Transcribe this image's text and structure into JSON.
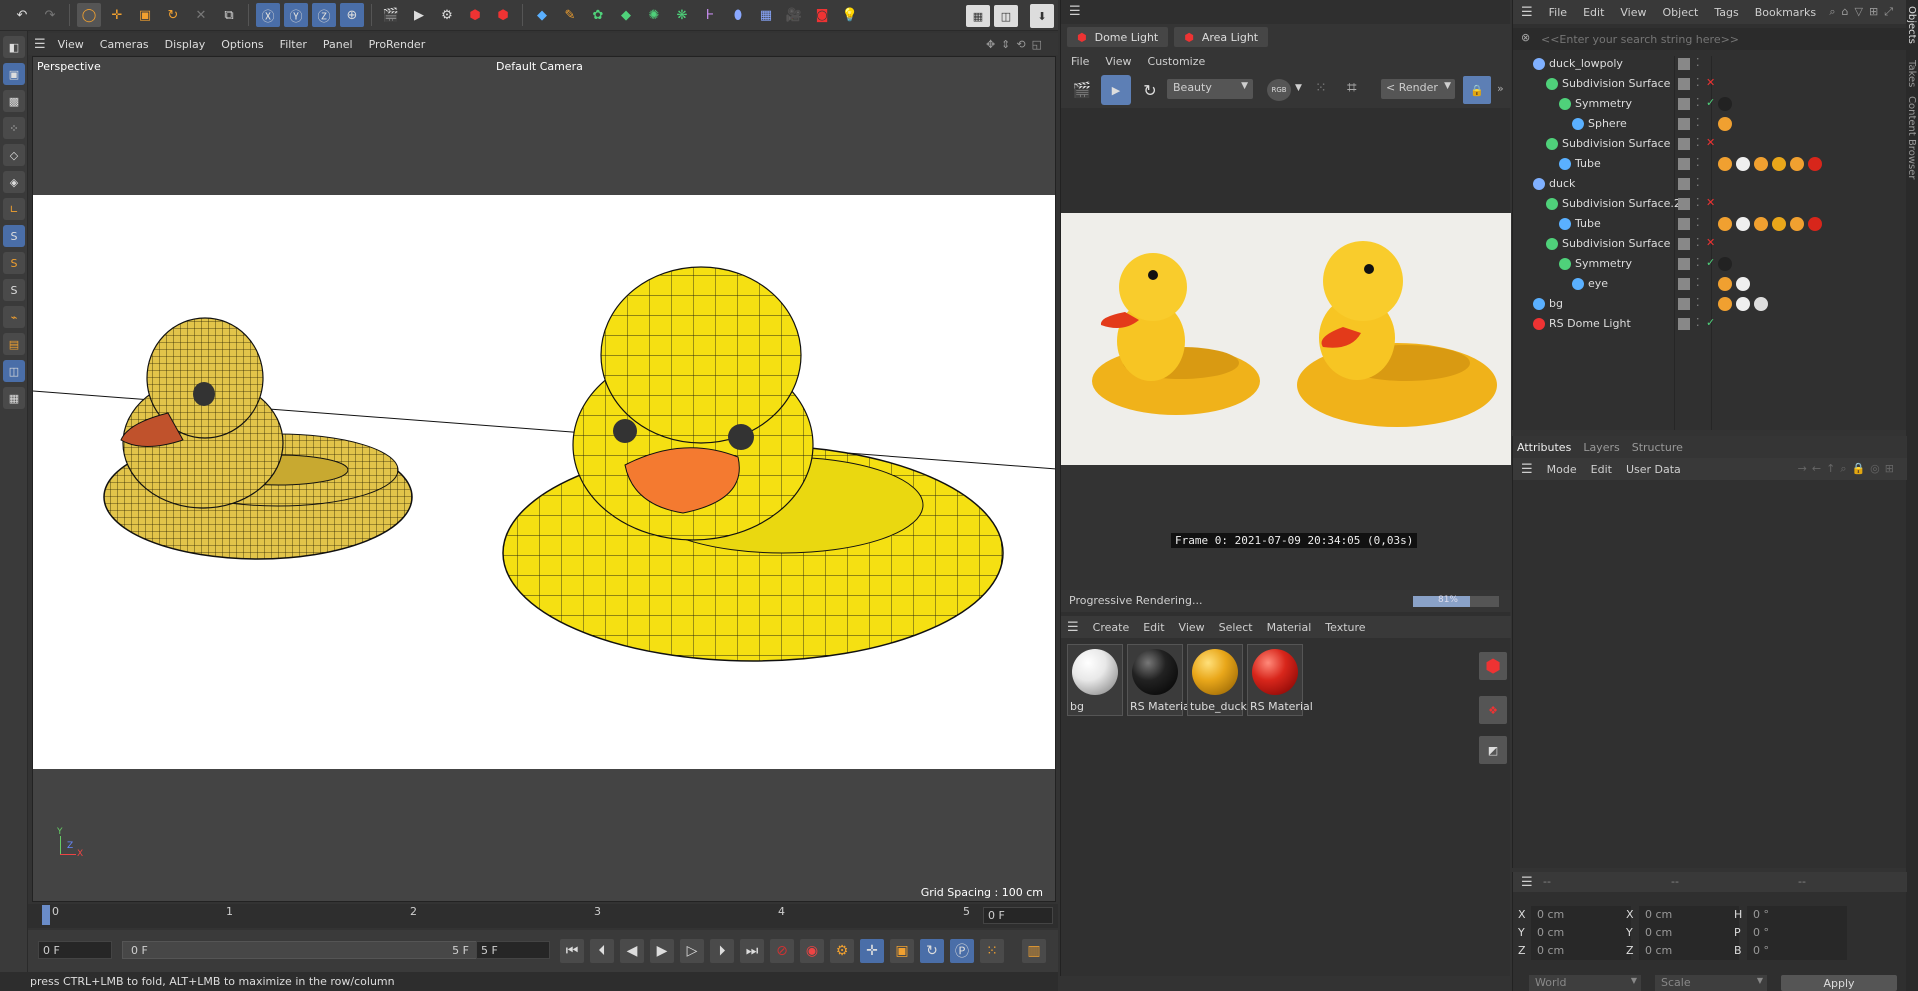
{
  "viewport": {
    "menu": [
      "View",
      "Cameras",
      "Display",
      "Options",
      "Filter",
      "Panel",
      "ProRender"
    ],
    "view_name": "Perspective",
    "camera_name": "Default Camera",
    "grid_spacing": "Grid Spacing : 100 cm",
    "axis_x": "X",
    "axis_y": "Y",
    "axis_z": "Z"
  },
  "timeline": {
    "ticks": [
      "0",
      "1",
      "2",
      "3",
      "4",
      "5"
    ],
    "current_frame": "0 F",
    "start_field": "0 F",
    "range_start": "0 F",
    "range_end": "5 F",
    "end_field": "5 F"
  },
  "status_text": "press CTRL+LMB to fold, ALT+LMB to maximize in the row/column",
  "render_view": {
    "tabs": [
      "Dome Light",
      "Area Light"
    ],
    "menu": [
      "File",
      "View",
      "Customize"
    ],
    "aov": "Beauty",
    "rgb_label": "RGB",
    "render_button": "< Render",
    "frame_info": "Frame  0:  2021-07-09  20:34:05  (0,03s)",
    "progress_label": "Progressive Rendering...",
    "progress_percent": "81%",
    "progress_value": 0.81
  },
  "material_manager": {
    "menu": [
      "Create",
      "Edit",
      "View",
      "Select",
      "Material",
      "Texture"
    ],
    "materials": [
      {
        "name": "bg",
        "color": "#e8e8e8"
      },
      {
        "name": "RS Material",
        "color": "#222222"
      },
      {
        "name": "tube_duck",
        "color": "#e9a71a"
      },
      {
        "name": "RS Material",
        "color": "#d8261b"
      }
    ]
  },
  "object_manager": {
    "menu": [
      "File",
      "Edit",
      "View",
      "Object",
      "Tags",
      "Bookmarks"
    ],
    "search_placeholder": "<<Enter your search string here>>",
    "objects": [
      {
        "name": "duck_lowpoly",
        "icon": "null-icon",
        "status": ""
      },
      {
        "name": "Subdivision Surface",
        "icon": "subdivision-icon",
        "status": "x"
      },
      {
        "name": "Symmetry",
        "icon": "symmetry-icon",
        "status": "check"
      },
      {
        "name": "Sphere",
        "icon": "sphere-icon",
        "status": ""
      },
      {
        "name": "Subdivision Surface",
        "icon": "subdivision-icon",
        "status": "x"
      },
      {
        "name": "Tube",
        "icon": "polygon-icon",
        "status": ""
      },
      {
        "name": "duck",
        "icon": "null-icon",
        "status": ""
      },
      {
        "name": "Subdivision Surface.2",
        "icon": "subdivision-icon",
        "status": "x"
      },
      {
        "name": "Tube",
        "icon": "polygon-icon",
        "status": ""
      },
      {
        "name": "Subdivision Surface",
        "icon": "subdivision-icon",
        "status": "x"
      },
      {
        "name": "Symmetry",
        "icon": "symmetry-icon",
        "status": "check"
      },
      {
        "name": "eye",
        "icon": "polygon-icon",
        "status": ""
      },
      {
        "name": "bg",
        "icon": "polygon-icon",
        "status": ""
      },
      {
        "name": "RS Dome Light",
        "icon": "light-icon",
        "status": "check"
      }
    ]
  },
  "side_tabs": [
    "Objects",
    "Takes",
    "Content Browser"
  ],
  "attributes": {
    "tabs": [
      "Attributes",
      "Layers",
      "Structure"
    ],
    "menu": [
      "Mode",
      "Edit",
      "User Data"
    ]
  },
  "coordinates": {
    "header": [
      "--",
      "--",
      "--"
    ],
    "rows": [
      {
        "a": "X",
        "av": "0 cm",
        "b": "X",
        "bv": "0 cm",
        "c": "H",
        "cv": "0 °"
      },
      {
        "a": "Y",
        "av": "0 cm",
        "b": "Y",
        "bv": "0 cm",
        "c": "P",
        "cv": "0 °"
      },
      {
        "a": "Z",
        "av": "0 cm",
        "b": "Z",
        "bv": "0 cm",
        "c": "B",
        "cv": "0 °"
      }
    ],
    "space": "World",
    "mode": "Scale",
    "apply": "Apply"
  }
}
